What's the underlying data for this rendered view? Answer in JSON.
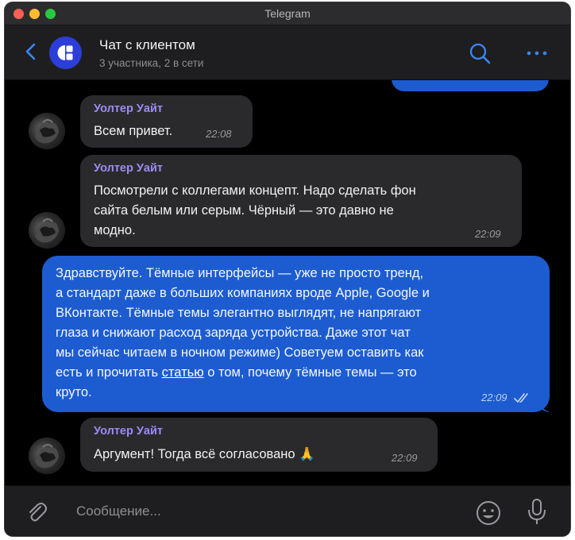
{
  "window": {
    "title": "Telegram"
  },
  "header": {
    "title": "Чат с клиентом",
    "subtitle": "3 участника, 2 в сети",
    "accent": "#2b3fd8"
  },
  "messages": [
    {
      "sender": "Уолтер Уайт",
      "text": "Всем привет.",
      "time": "22:08"
    },
    {
      "sender": "Уолтер Уайт",
      "text": "Посмотрели с коллегами концепт. Надо сделать фон\nсайта белым или серым. Чёрный — это давно не\nмодно.",
      "time": "22:09"
    },
    {
      "outgoing": true,
      "lines": [
        "Здравствуйте. Тёмные интерфейсы — уже не просто тренд,",
        "а стандарт даже в больших компаниях вроде Apple, Google и",
        "ВКонтакте. Тёмные темы элегантно выглядят, не напрягают",
        "глаза и снижают расход заряда устройства. Даже этот чат",
        "мы сейчас читаем в ночном режиме) Советуем оставить как"
      ],
      "last_line_before": "есть и прочитать ",
      "link_text": "статью",
      "last_line_after": " о том, почему тёмные темы — это",
      "final_line": "круто.",
      "time": "22:09",
      "status": "read",
      "bubble_color": "#1d5cd0"
    },
    {
      "sender": "Уолтер Уайт",
      "text": "Аргумент! Тогда всё согласовано",
      "emoji": "🙏",
      "time": "22:09"
    }
  ],
  "composer": {
    "placeholder": "Сообщение..."
  }
}
